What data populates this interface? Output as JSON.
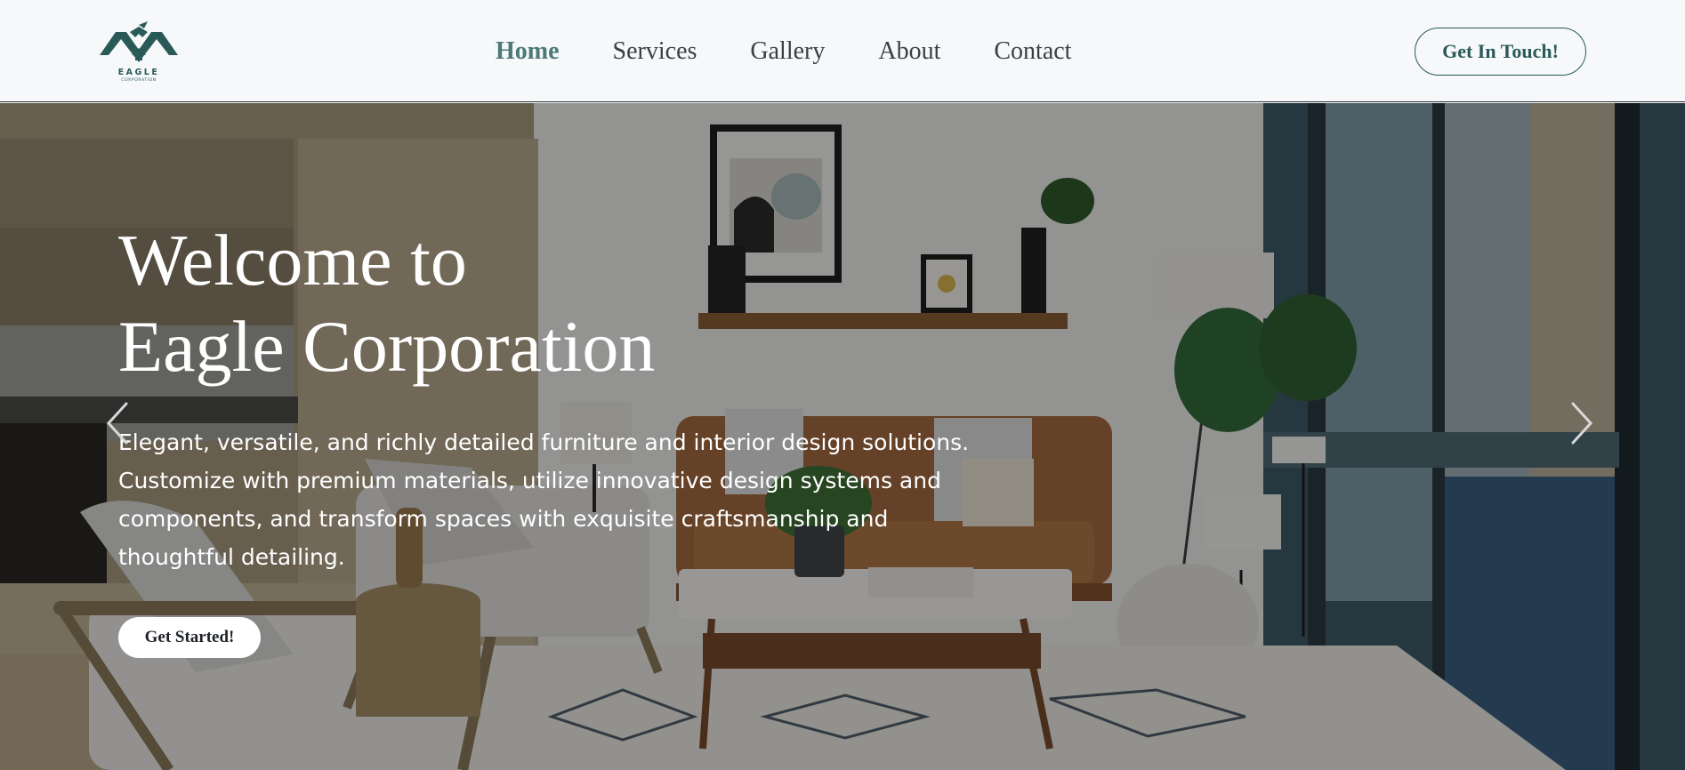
{
  "header": {
    "logo": {
      "name": "EAGLE",
      "subtitle": "CORPORATION",
      "icon": "eagle-logo-icon"
    },
    "nav": [
      {
        "label": "Home",
        "active": true
      },
      {
        "label": "Services",
        "active": false
      },
      {
        "label": "Gallery",
        "active": false
      },
      {
        "label": "About",
        "active": false
      },
      {
        "label": "Contact",
        "active": false
      }
    ],
    "cta_label": "Get In Touch!"
  },
  "hero": {
    "title_line1": "Welcome to",
    "title_line2": "Eagle Corporation",
    "description_lines": [
      "Elegant, versatile, and richly detailed furniture and interior design solutions.",
      "Customize with premium materials, utilize innovative design systems and",
      "components, and transform spaces with exquisite craftsmanship and",
      "thoughtful detailing."
    ],
    "cta_label": "Get Started!",
    "prev_icon": "chevron-left-icon",
    "next_icon": "chevron-right-icon"
  },
  "colors": {
    "brand": "#2a5a58",
    "nav_active": "#4d7a76",
    "nav_text": "#3a3f44",
    "header_bg": "#f6f8fa",
    "hero_text": "#ffffff"
  }
}
